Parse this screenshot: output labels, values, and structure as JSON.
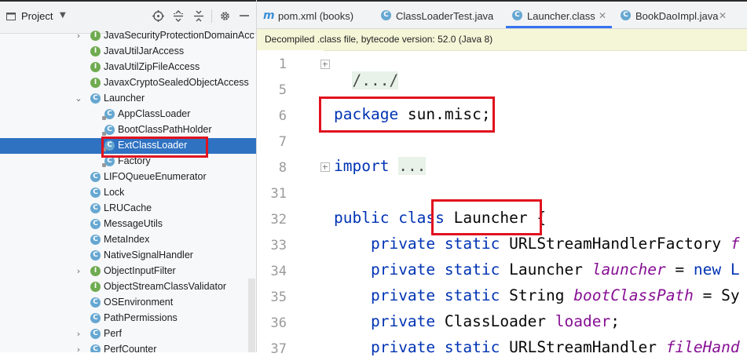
{
  "project_panel": {
    "title": "Project",
    "tree": [
      {
        "label": "JavaSecurityProtectionDomainAcc",
        "icon": "interface",
        "arrow": "collapsed"
      },
      {
        "label": "JavaUtilJarAccess",
        "icon": "interface",
        "arrow": ""
      },
      {
        "label": "JavaUtilZipFileAccess",
        "icon": "interface",
        "arrow": ""
      },
      {
        "label": "JavaxCryptoSealedObjectAccess",
        "icon": "interface",
        "arrow": ""
      },
      {
        "label": "Launcher",
        "icon": "class",
        "arrow": "expanded"
      },
      {
        "label": "AppClassLoader",
        "icon": "inner-class",
        "arrow": ""
      },
      {
        "label": "BootClassPathHolder",
        "icon": "inner-class",
        "arrow": ""
      },
      {
        "label": "ExtClassLoader",
        "icon": "inner-class",
        "arrow": "",
        "selected": true
      },
      {
        "label": "Factory",
        "icon": "inner-class",
        "arrow": ""
      },
      {
        "label": "LIFOQueueEnumerator",
        "icon": "class",
        "arrow": ""
      },
      {
        "label": "Lock",
        "icon": "class",
        "arrow": ""
      },
      {
        "label": "LRUCache",
        "icon": "class",
        "arrow": ""
      },
      {
        "label": "MessageUtils",
        "icon": "class",
        "arrow": ""
      },
      {
        "label": "MetaIndex",
        "icon": "class",
        "arrow": ""
      },
      {
        "label": "NativeSignalHandler",
        "icon": "class",
        "arrow": ""
      },
      {
        "label": "ObjectInputFilter",
        "icon": "interface",
        "arrow": "collapsed"
      },
      {
        "label": "ObjectStreamClassValidator",
        "icon": "interface",
        "arrow": ""
      },
      {
        "label": "OSEnvironment",
        "icon": "class",
        "arrow": ""
      },
      {
        "label": "PathPermissions",
        "icon": "class",
        "arrow": ""
      },
      {
        "label": "Perf",
        "icon": "class",
        "arrow": "collapsed"
      },
      {
        "label": "PerfCounter",
        "icon": "class",
        "arrow": "collapsed"
      }
    ]
  },
  "editor": {
    "tabs": [
      {
        "label": "pom.xml (books)",
        "icon": "maven-icon",
        "active": false
      },
      {
        "label": "ClassLoaderTest.java",
        "icon": "class-icon",
        "active": false
      },
      {
        "label": "Launcher.class",
        "icon": "class-icon",
        "active": true
      },
      {
        "label": "BookDaoImpl.java",
        "icon": "class-icon",
        "active": false
      }
    ],
    "info_banner": "Decompiled .class file, bytecode version: 52.0 (Java 8)",
    "line_numbers": [
      "1",
      "5",
      "6",
      "7",
      "8",
      "31",
      "32",
      "33",
      "34",
      "35",
      "36",
      "37"
    ],
    "code": {
      "line1": "/.../",
      "line6_kw": "package",
      "line6_rest": " sun.misc;",
      "line8_kw": "import",
      "line8_rest": "...",
      "line32_kw1": "public",
      "line32_kw2": "class",
      "line32_name": "Launcher",
      "line32_brace": "{",
      "line33_kw": "private static",
      "line33_type": "URLStreamHandlerFactory",
      "line33_field": "f",
      "line34_kw": "private static",
      "line34_type": "Launcher",
      "line34_field": "launcher",
      "line34_rest": "new L",
      "line35_kw": "private static",
      "line35_type": "String",
      "line35_field": "bootClassPath",
      "line35_rest": "Sy",
      "line36_kw": "private",
      "line36_type": "ClassLoader",
      "line36_field": "loader",
      "line37_kw": "private static",
      "line37_type": "URLStreamHandler",
      "line37_field": "fileHand"
    }
  },
  "colors": {
    "selection": "#2f72c2",
    "keyword": "#0033b3",
    "field": "#871094",
    "highlight_box": "#e0121e"
  }
}
